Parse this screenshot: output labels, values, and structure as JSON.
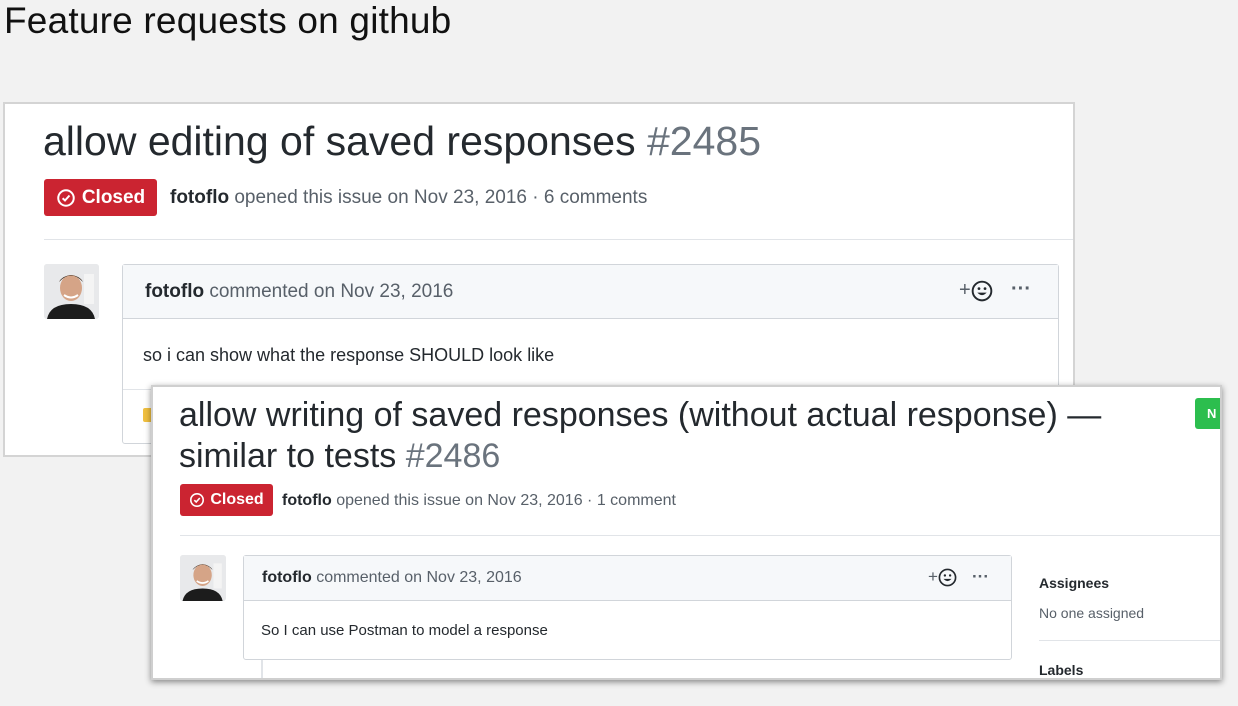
{
  "slide": {
    "title": "Feature requests on github"
  },
  "issue1": {
    "title": "allow editing of saved responses",
    "number": "#2485",
    "state": "Closed",
    "author": "fotoflo",
    "opened_text": "opened this issue on Nov 23, 2016 · 6 comments",
    "comment": {
      "author": "fotoflo",
      "commented_text": "commented on Nov 23, 2016",
      "react_plus": "+",
      "more": "···",
      "body": "so i can show what the response SHOULD look like"
    }
  },
  "issue2": {
    "title_line1": "allow writing of saved responses (without actual response) —",
    "title_line2": "similar to tests",
    "number": "#2486",
    "state": "Closed",
    "author": "fotoflo",
    "opened_text": "opened this issue on Nov 23, 2016 · 1 comment",
    "new_issue_button": "N",
    "comment": {
      "author": "fotoflo",
      "commented_text": "commented on Nov 23, 2016",
      "react_plus": "+",
      "more": "···",
      "body": "So I can use Postman to model a response"
    },
    "sidebar": {
      "assignees_label": "Assignees",
      "assignees_value": "No one assigned",
      "labels_label": "Labels"
    }
  },
  "colors": {
    "closed": "#cb2431",
    "green": "#2cbe4e",
    "muted": "#586069"
  },
  "icons": [
    "issue-closed-icon",
    "smiley-icon",
    "kebab-icon",
    "avatar"
  ]
}
